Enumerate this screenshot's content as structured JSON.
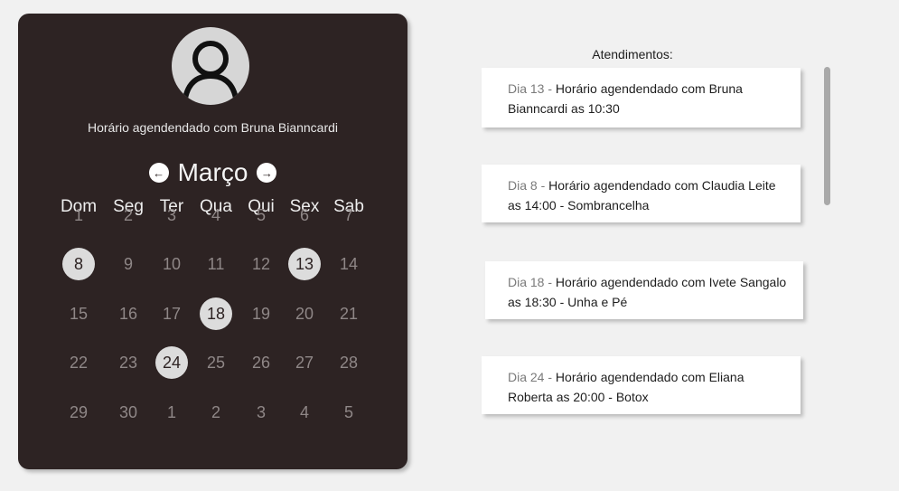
{
  "profile": {
    "title": "Horário agendendado com Bruna Bianncardi"
  },
  "calendar": {
    "month": "Março",
    "prev_icon": "arrow-left-icon",
    "next_icon": "arrow-right-icon",
    "weekdays": [
      "Dom",
      "Seg",
      "Ter",
      "Qua",
      "Qui",
      "Sex",
      "Sab"
    ],
    "weeks": [
      [
        "1",
        "2",
        "3",
        "4",
        "5",
        "6",
        "7"
      ],
      [
        "8",
        "9",
        "10",
        "11",
        "12",
        "13",
        "14"
      ],
      [
        "15",
        "16",
        "17",
        "18",
        "19",
        "20",
        "21"
      ],
      [
        "22",
        "23",
        "24",
        "25",
        "26",
        "27",
        "28"
      ],
      [
        "29",
        "30",
        "1",
        "2",
        "3",
        "4",
        "5"
      ]
    ],
    "booked_days": [
      "8",
      "13",
      "18",
      "24"
    ],
    "colors": {
      "panel_bg": "#2d2323",
      "booked_bg": "#dcdcdc",
      "day_text": "#8f8787"
    }
  },
  "appointments": {
    "title": "Atendimentos:",
    "items": [
      {
        "day": "Dia 13",
        "separator": " - ",
        "text": "Horário agendendado com Bruna Bianncardi as 10:30"
      },
      {
        "day": "Dia 8",
        "separator": " - ",
        "text": "Horário agendendado com Claudia Leite as 14:00 - Sombrancelha"
      },
      {
        "day": "Dia 18",
        "separator": " - ",
        "text": "Horário agendendado com Ivete Sangalo as 18:30 - Unha e Pé"
      },
      {
        "day": "Dia 24",
        "separator": " - ",
        "text": "Horário agendendado com Eliana Roberta as 20:00 - Botox"
      }
    ]
  }
}
